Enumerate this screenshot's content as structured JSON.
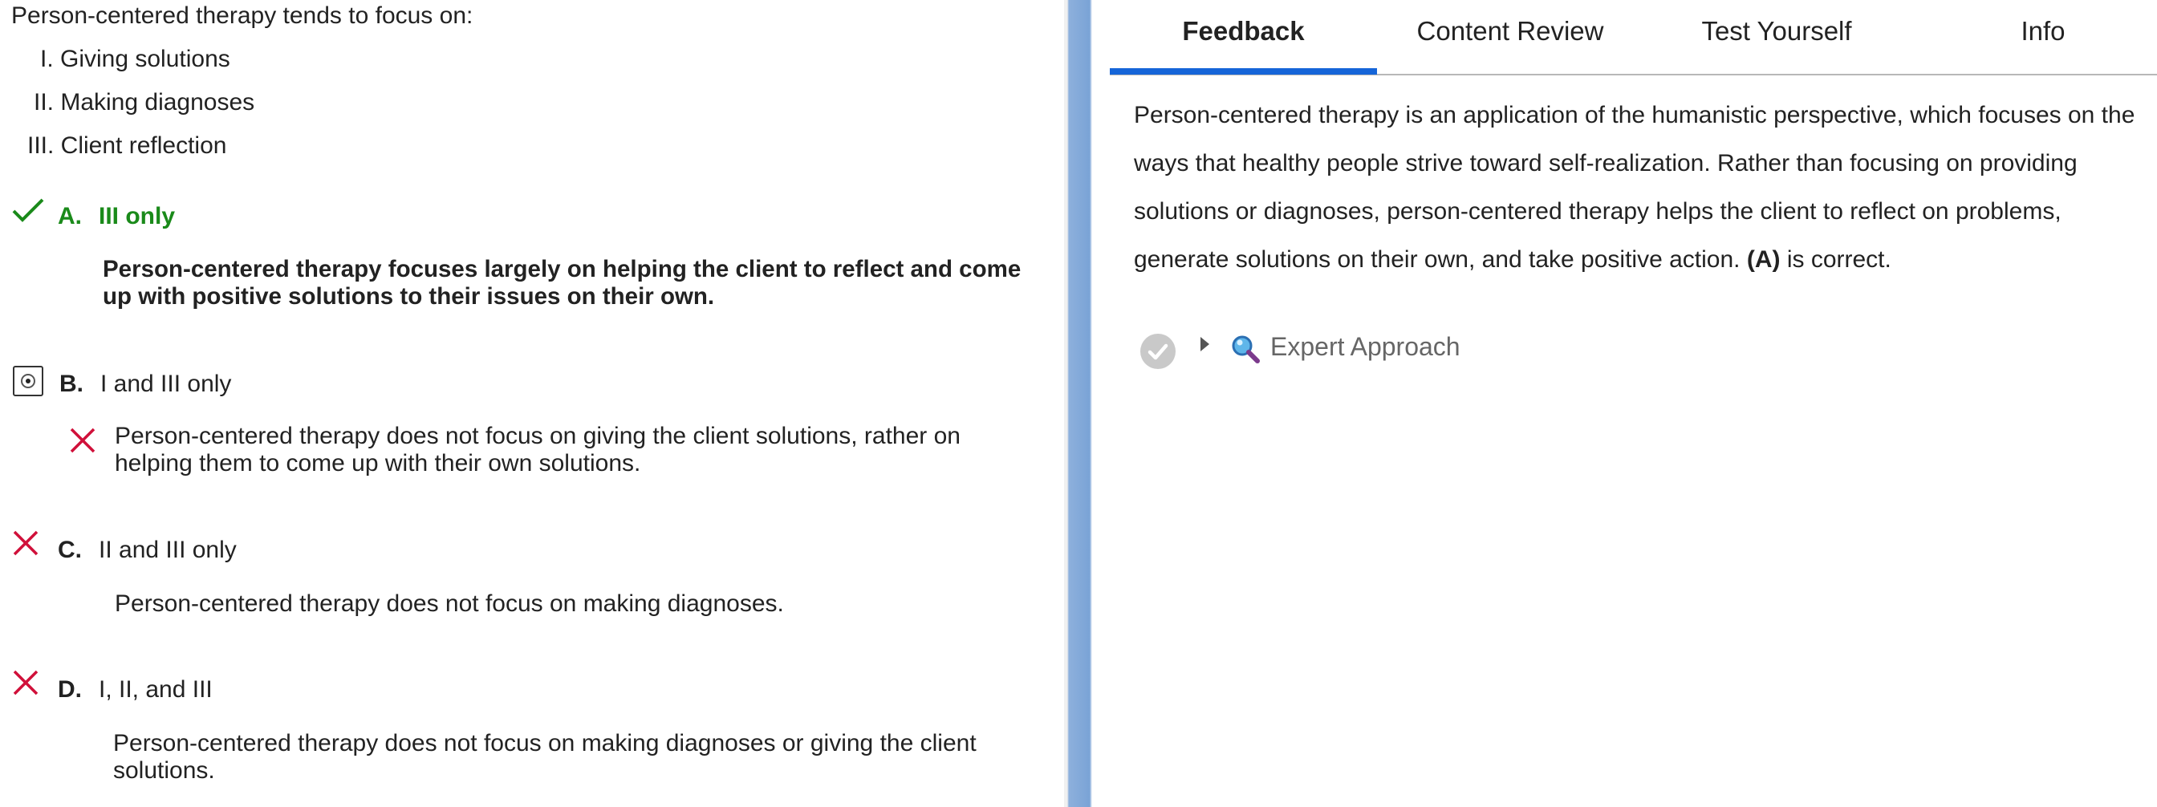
{
  "question": {
    "stem": "Person-centered therapy tends to focus on:",
    "statements": [
      "I. Giving solutions",
      "II. Making diagnoses",
      "III. Client reflection"
    ]
  },
  "choices": [
    {
      "letter": "A.",
      "text": "III only",
      "status": "correct",
      "explanation": [
        "Person-centered therapy focuses largely on helping the client to reflect and come",
        "up with positive solutions to their issues on their own."
      ]
    },
    {
      "letter": "B.",
      "text": "I and III only",
      "status": "selected-incorrect",
      "explanation": [
        "Person-centered therapy does not focus on giving the client solutions, rather on",
        "helping them to come up with their own solutions."
      ]
    },
    {
      "letter": "C.",
      "text": "II and III only",
      "status": "incorrect",
      "explanation": [
        "Person-centered therapy does not focus on making diagnoses."
      ]
    },
    {
      "letter": "D.",
      "text": "I, II, and III",
      "status": "incorrect",
      "explanation": [
        "Person-centered therapy does not focus on making diagnoses or giving the client",
        "solutions."
      ]
    }
  ],
  "tabs": [
    {
      "label": "Feedback",
      "active": true
    },
    {
      "label": "Content Review",
      "active": false
    },
    {
      "label": "Test Yourself",
      "active": false
    },
    {
      "label": "Info",
      "active": false
    }
  ],
  "feedback": {
    "lines": [
      "Person-centered therapy is an application of the humanistic perspective, which focuses on the",
      "ways that healthy people strive toward self-realization. Rather than focusing on providing",
      "solutions or diagnoses, person-centered therapy helps the client to reflect on problems,"
    ],
    "last_line_prefix": "generate solutions on their own, and take positive action. ",
    "answer_ref": "(A)",
    "last_line_suffix": " is correct."
  },
  "expert_approach": {
    "label": "Expert Approach",
    "icon": "magnifier-icon"
  },
  "colors": {
    "correct": "#1a8a1a",
    "incorrect": "#d0103a",
    "tab_accent": "#1565d8",
    "divider": "#7aa3d6"
  }
}
